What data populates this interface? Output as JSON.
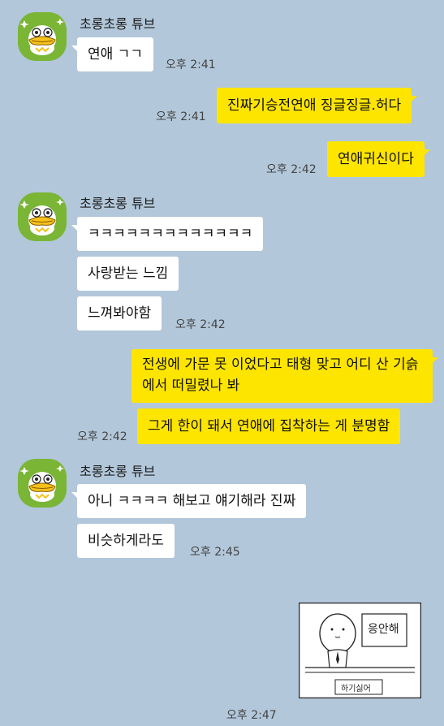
{
  "messages": [
    {
      "sender": "초롱초롱 튜브",
      "text": "연애 ㄱㄱ",
      "time": "오후 2:41"
    },
    {
      "self": true,
      "text": "진짜기승전연애 징글징글.허다",
      "time": "오후 2:41"
    },
    {
      "self": true,
      "text": "연애귀신이다",
      "time": "오후 2:42"
    },
    {
      "sender": "초롱초롱 튜브",
      "text": "ㅋㅋㅋㅋㅋㅋㅋㅋㅋㅋㅋㅋㅋ"
    },
    {
      "text": "사랑받는 느낌"
    },
    {
      "text": "느껴봐야함",
      "time": "오후 2:42"
    },
    {
      "self": true,
      "text": "전생에 가문 못 이었다고 태형 맞고 어디 산 기슭에서 떠밀렸나 봐"
    },
    {
      "self": true,
      "text": "그게 한이 돼서 연애에 집착하는 게 분명함",
      "time": "오후 2:42"
    },
    {
      "sender": "초롱초롱 튜브",
      "text": "아니 ㅋㅋㅋㅋ 해보고 얘기해라 진짜"
    },
    {
      "text": "비슷하게라도",
      "time": "오후 2:45"
    },
    {
      "self": true,
      "image": true,
      "sticker_sign": "응안해",
      "sticker_caption": "하기싫어",
      "time": "오후 2:47"
    }
  ],
  "colors": {
    "background": "#b2c7da",
    "my_bubble": "#fee500",
    "their_bubble": "#ffffff",
    "avatar": "#7ab536"
  },
  "icons": {
    "avatar": "tube-duck-avatar-icon"
  }
}
